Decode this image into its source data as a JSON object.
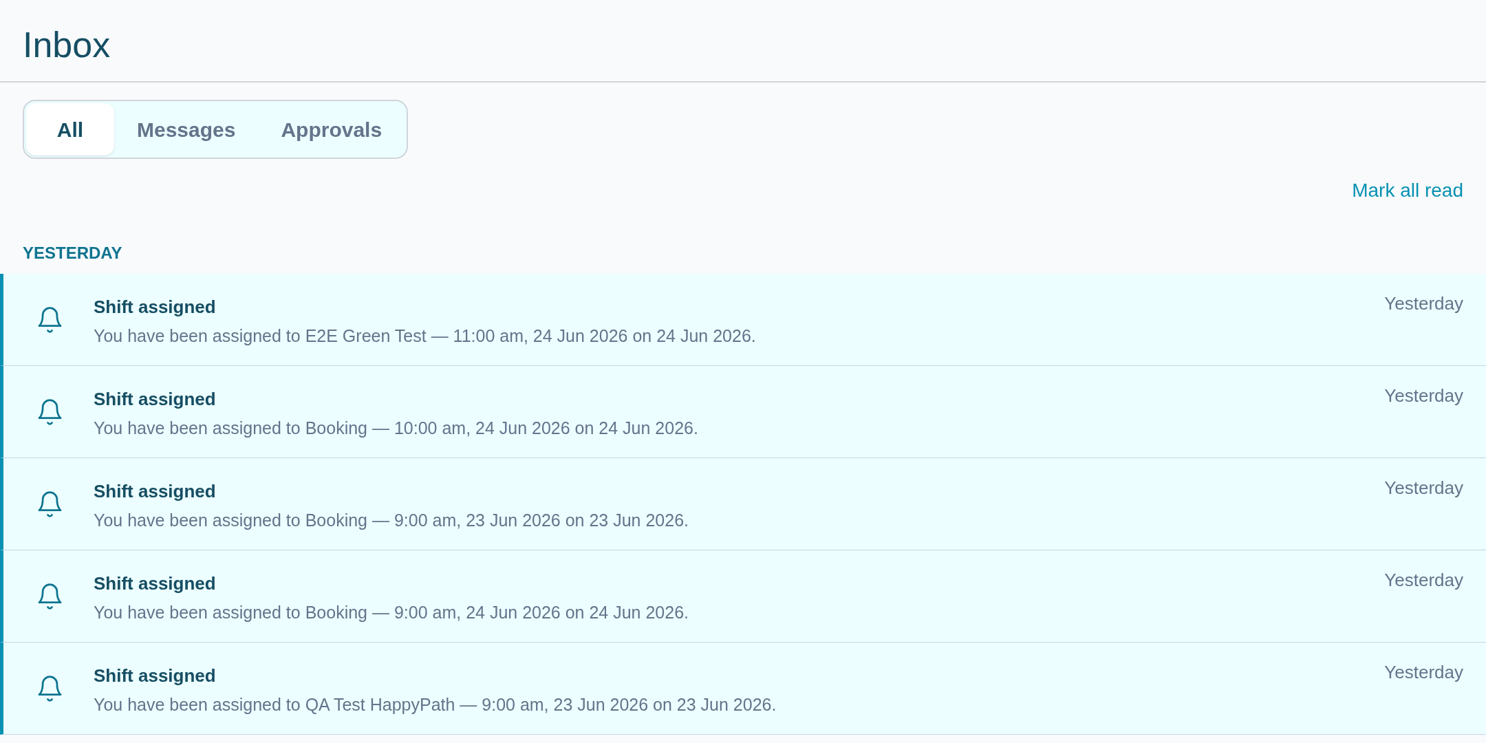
{
  "page": {
    "title": "Inbox"
  },
  "tabs": [
    {
      "label": "All",
      "selected": true
    },
    {
      "label": "Messages",
      "selected": false
    },
    {
      "label": "Approvals",
      "selected": false
    }
  ],
  "actions": {
    "mark_all_read": "Mark all read"
  },
  "groups": [
    {
      "heading": "YESTERDAY",
      "notifications": [
        {
          "title": "Shift assigned",
          "body": "You have been assigned to E2E Green Test — 11:00 am, 24 Jun 2026 on 24 Jun 2026.",
          "time": "Yesterday",
          "unread": true
        },
        {
          "title": "Shift assigned",
          "body": "You have been assigned to Booking — 10:00 am, 24 Jun 2026 on 24 Jun 2026.",
          "time": "Yesterday",
          "unread": true
        },
        {
          "title": "Shift assigned",
          "body": "You have been assigned to Booking — 9:00 am, 23 Jun 2026 on 23 Jun 2026.",
          "time": "Yesterday",
          "unread": true
        },
        {
          "title": "Shift assigned",
          "body": "You have been assigned to Booking — 9:00 am, 24 Jun 2026 on 24 Jun 2026.",
          "time": "Yesterday",
          "unread": true
        },
        {
          "title": "Shift assigned",
          "body": "You have been assigned to QA Test HappyPath — 9:00 am, 23 Jun 2026 on 23 Jun 2026.",
          "time": "Yesterday",
          "unread": true
        }
      ]
    }
  ]
}
